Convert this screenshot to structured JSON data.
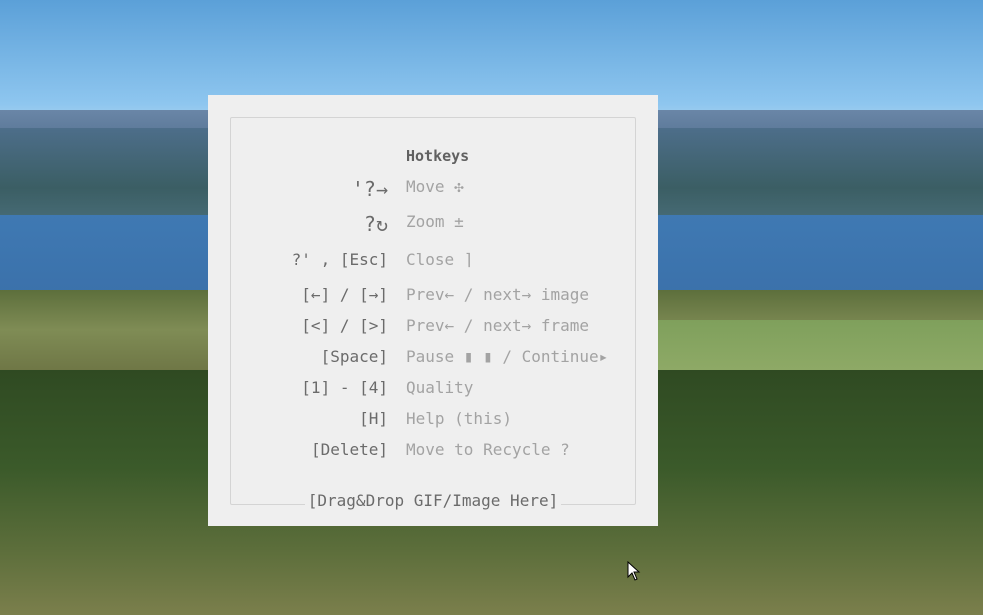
{
  "hotkeys": {
    "title": "Hotkeys",
    "rows": [
      {
        "key": "'?→",
        "desc": "Move",
        "desc_icon": "✣"
      },
      {
        "key": "?↻",
        "desc": "Zoom",
        "desc_icon": "±"
      },
      {
        "key": "?' , [Esc]",
        "desc": "Close",
        "desc_icon": "⌉"
      },
      {
        "key": "[←] / [→]",
        "desc": "Prev← / next→ image",
        "desc_icon": ""
      },
      {
        "key": "[<] / [>]",
        "desc": "Prev← / next→ frame",
        "desc_icon": ""
      },
      {
        "key": "[Space]",
        "desc": "Pause ▮ ▮ / Continue▸",
        "desc_icon": ""
      },
      {
        "key": "[1] - [4]",
        "desc": "Quality",
        "desc_icon": ""
      },
      {
        "key": "[H]",
        "desc": "Help (this)",
        "desc_icon": ""
      },
      {
        "key": "[Delete]",
        "desc": "Move to Recycle",
        "desc_icon": "?"
      }
    ],
    "drop_text": "[Drag&Drop GIF/Image Here]"
  },
  "icons": [
    "move-icon",
    "zoom-icon",
    "close-icon",
    "recycle-icon",
    "mouse-cursor-icon"
  ]
}
